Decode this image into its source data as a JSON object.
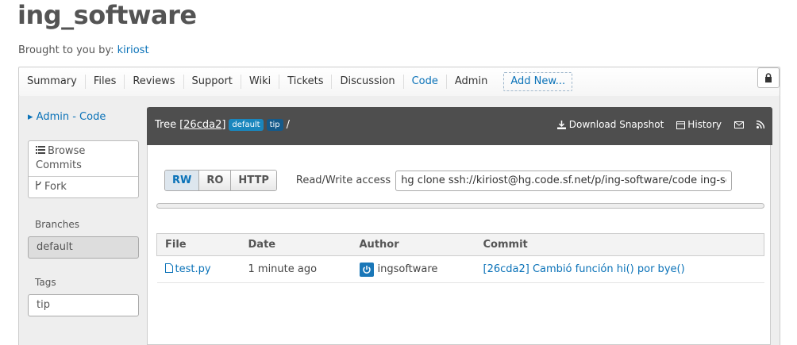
{
  "project": {
    "title": "ing_software",
    "brought_by_label": "Brought to you by:",
    "owner": "kiriost"
  },
  "nav": {
    "items": [
      {
        "label": "Summary"
      },
      {
        "label": "Files"
      },
      {
        "label": "Reviews"
      },
      {
        "label": "Support"
      },
      {
        "label": "Wiki"
      },
      {
        "label": "Tickets"
      },
      {
        "label": "Discussion"
      },
      {
        "label": "Code",
        "active": true
      },
      {
        "label": "Admin"
      }
    ],
    "add_new": "Add New...",
    "lock_icon": "lock-icon"
  },
  "sidebar": {
    "admin_link": "▸ Admin - Code",
    "browse_commits": "Browse Commits",
    "fork": "Fork",
    "branches_label": "Branches",
    "branch": "default",
    "tags_label": "Tags",
    "tag": "tip"
  },
  "header": {
    "tree_label": "Tree",
    "commit_hash": "[26cda2]",
    "badge_default": "default",
    "badge_tip": "tip",
    "path": "/",
    "download_snapshot": "Download Snapshot",
    "history": "History"
  },
  "clone": {
    "buttons": [
      "RW",
      "RO",
      "HTTP"
    ],
    "selected": "RW",
    "access_label": "Read/Write access",
    "command": "hg clone ssh://kiriost@hg.code.sf.net/p/ing-software/code ing-software-code"
  },
  "table": {
    "headers": [
      "File",
      "Date",
      "Author",
      "Commit"
    ],
    "rows": [
      {
        "file": "test.py",
        "date": "1 minute ago",
        "author": "ingsoftware",
        "commit": "[26cda2] Cambió función hi() por bye()"
      }
    ]
  },
  "colors": {
    "link": "#0a72b8",
    "header_bg": "#4e4e4e",
    "badge": "#1a86bd"
  }
}
